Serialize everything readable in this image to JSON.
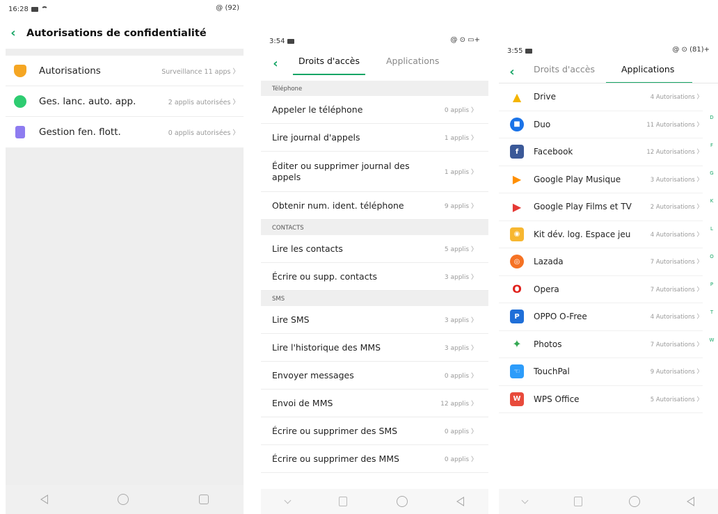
{
  "screen1": {
    "status_time": "16:28",
    "status_right": "@ (92)",
    "title": "Autorisations de confidentialité",
    "items": [
      {
        "label": "Autorisations",
        "value": "Surveillance 11 apps",
        "icon": "shield-icon",
        "color": "#f5a623"
      },
      {
        "label": "Ges. lanc. auto. app.",
        "value": "2 applis autorisées",
        "icon": "autostart-icon",
        "color": "#2ecc71"
      },
      {
        "label": "Gestion fen. flott.",
        "value": "0 applis autorisées",
        "icon": "floating-window-icon",
        "color": "#8e7cf0"
      }
    ]
  },
  "screen2": {
    "status_time": "3:54",
    "status_right": "@ ⊙ ▭+",
    "tab_active": "Droits d'accès",
    "tab_inactive": "Applications",
    "sections": [
      {
        "title": "Téléphone",
        "items": [
          {
            "label": "Appeler le téléphone",
            "value": "0 applis"
          },
          {
            "label": "Lire journal d'appels",
            "value": "1 applis"
          },
          {
            "label": "Éditer ou supprimer journal des appels",
            "value": "1 applis"
          },
          {
            "label": "Obtenir num. ident. téléphone",
            "value": "9 applis"
          }
        ]
      },
      {
        "title": "CONTACTS",
        "items": [
          {
            "label": "Lire les contacts",
            "value": "5 applis"
          },
          {
            "label": "Écrire ou supp. contacts",
            "value": "3 applis"
          }
        ]
      },
      {
        "title": "SMS",
        "items": [
          {
            "label": "Lire SMS",
            "value": "3 applis"
          },
          {
            "label": "Lire l'historique des MMS",
            "value": "3 applis"
          },
          {
            "label": "Envoyer messages",
            "value": "0 applis"
          },
          {
            "label": "Envoi de MMS",
            "value": "12 applis"
          },
          {
            "label": "Écrire ou supprimer des SMS",
            "value": "0 applis"
          },
          {
            "label": "Écrire ou supprimer des MMS",
            "value": "0 applis"
          }
        ]
      }
    ]
  },
  "screen3": {
    "status_time": "3:55",
    "status_right": "@ ⊙ (81)+",
    "tab_inactive": "Droits d'accès",
    "tab_active": "Applications",
    "apps": [
      {
        "name": "Drive",
        "value": "4 Autorisations",
        "icon": "drive-icon",
        "color": "#f4b400"
      },
      {
        "name": "Duo",
        "value": "11 Autorisations",
        "icon": "duo-icon",
        "color": "#1a73e8"
      },
      {
        "name": "Facebook",
        "value": "12 Autorisations",
        "icon": "facebook-icon",
        "color": "#3b5998"
      },
      {
        "name": "Google Play Musique",
        "value": "3 Autorisations",
        "icon": "play-music-icon",
        "color": "#ff8f00"
      },
      {
        "name": "Google Play Films et TV",
        "value": "2 Autorisations",
        "icon": "play-movies-icon",
        "color": "#e53935"
      },
      {
        "name": "Kit dév. log. Espace jeu",
        "value": "4 Autorisations",
        "icon": "game-space-icon",
        "color": "#f7b731"
      },
      {
        "name": "Lazada",
        "value": "7 Autorisations",
        "icon": "lazada-icon",
        "color": "#f57224"
      },
      {
        "name": "Opera",
        "value": "7 Autorisations",
        "icon": "opera-icon",
        "color": "#e0201b"
      },
      {
        "name": "OPPO O-Free",
        "value": "4 Autorisations",
        "icon": "o-free-icon",
        "color": "#1f6fd8"
      },
      {
        "name": "Photos",
        "value": "7 Autorisations",
        "icon": "photos-icon",
        "color": "#34a853"
      },
      {
        "name": "TouchPal",
        "value": "9 Autorisations",
        "icon": "touchpal-icon",
        "color": "#2d9cfa"
      },
      {
        "name": "WPS Office",
        "value": "5 Autorisations",
        "icon": "wps-office-icon",
        "color": "#e84a3b"
      }
    ],
    "index_letters": [
      "D",
      "F",
      "G",
      "K",
      "L",
      "O",
      "P",
      "T",
      "W"
    ]
  },
  "accent_color": "#16a565"
}
